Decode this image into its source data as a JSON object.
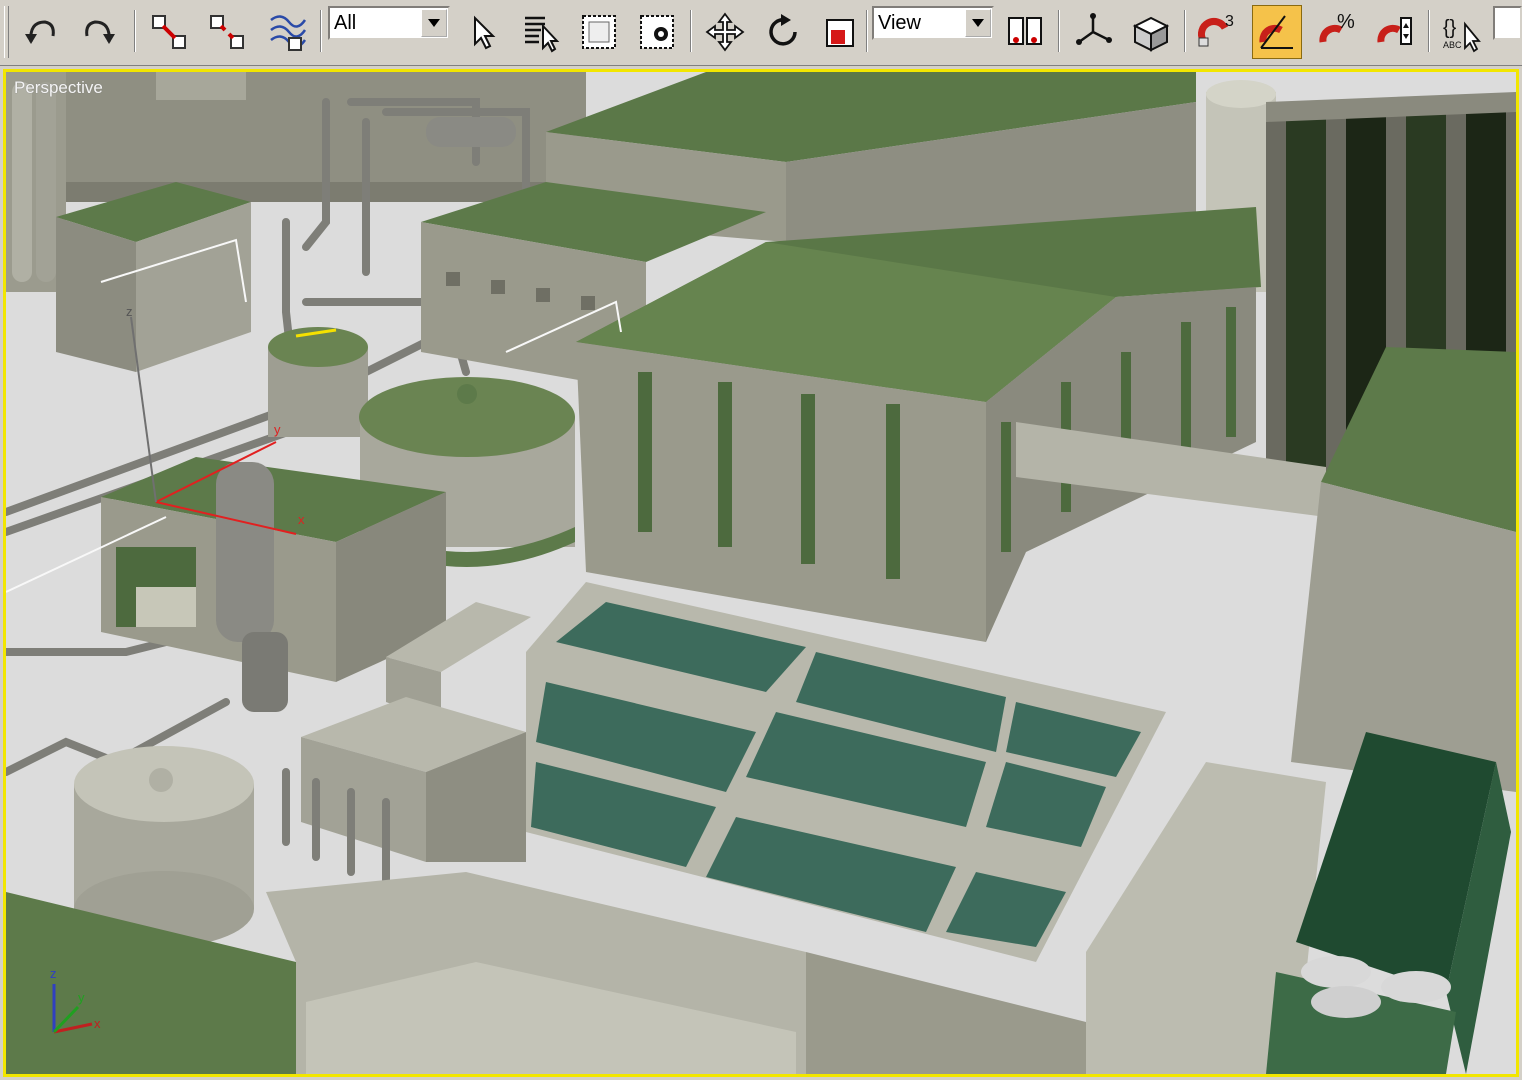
{
  "toolbar": {
    "selection_filter": {
      "value": "All"
    },
    "reference_coord": {
      "value": "View"
    },
    "snap_count_label": "3",
    "percent_snap_label": "%",
    "named_sets_label": "ABC"
  },
  "viewport": {
    "label": "Perspective",
    "gizmo": {
      "x": "x",
      "y": "y",
      "z": "z"
    },
    "axis_tripod": {
      "x": "x",
      "y": "y",
      "z": "z"
    }
  },
  "colors": {
    "roof_green": "#5d7a4a",
    "wall_gray": "#9a9a8c",
    "water_teal": "#3d6b5c",
    "viewport_border": "#f2e600",
    "active_tool": "#f5c24a"
  },
  "icons": [
    "undo-icon",
    "redo-icon",
    "select-link-icon",
    "unlink-icon",
    "bind-space-warp-icon",
    "select-object-icon",
    "select-by-name-icon",
    "rect-selection-icon",
    "window-crossing-icon",
    "move-icon",
    "rotate-icon",
    "scale-icon",
    "mirror-icon",
    "pivot-icon",
    "manipulate-icon",
    "snap-icon",
    "angle-snap-icon",
    "percent-snap-icon",
    "spinner-snap-icon",
    "named-selection-icon"
  ]
}
